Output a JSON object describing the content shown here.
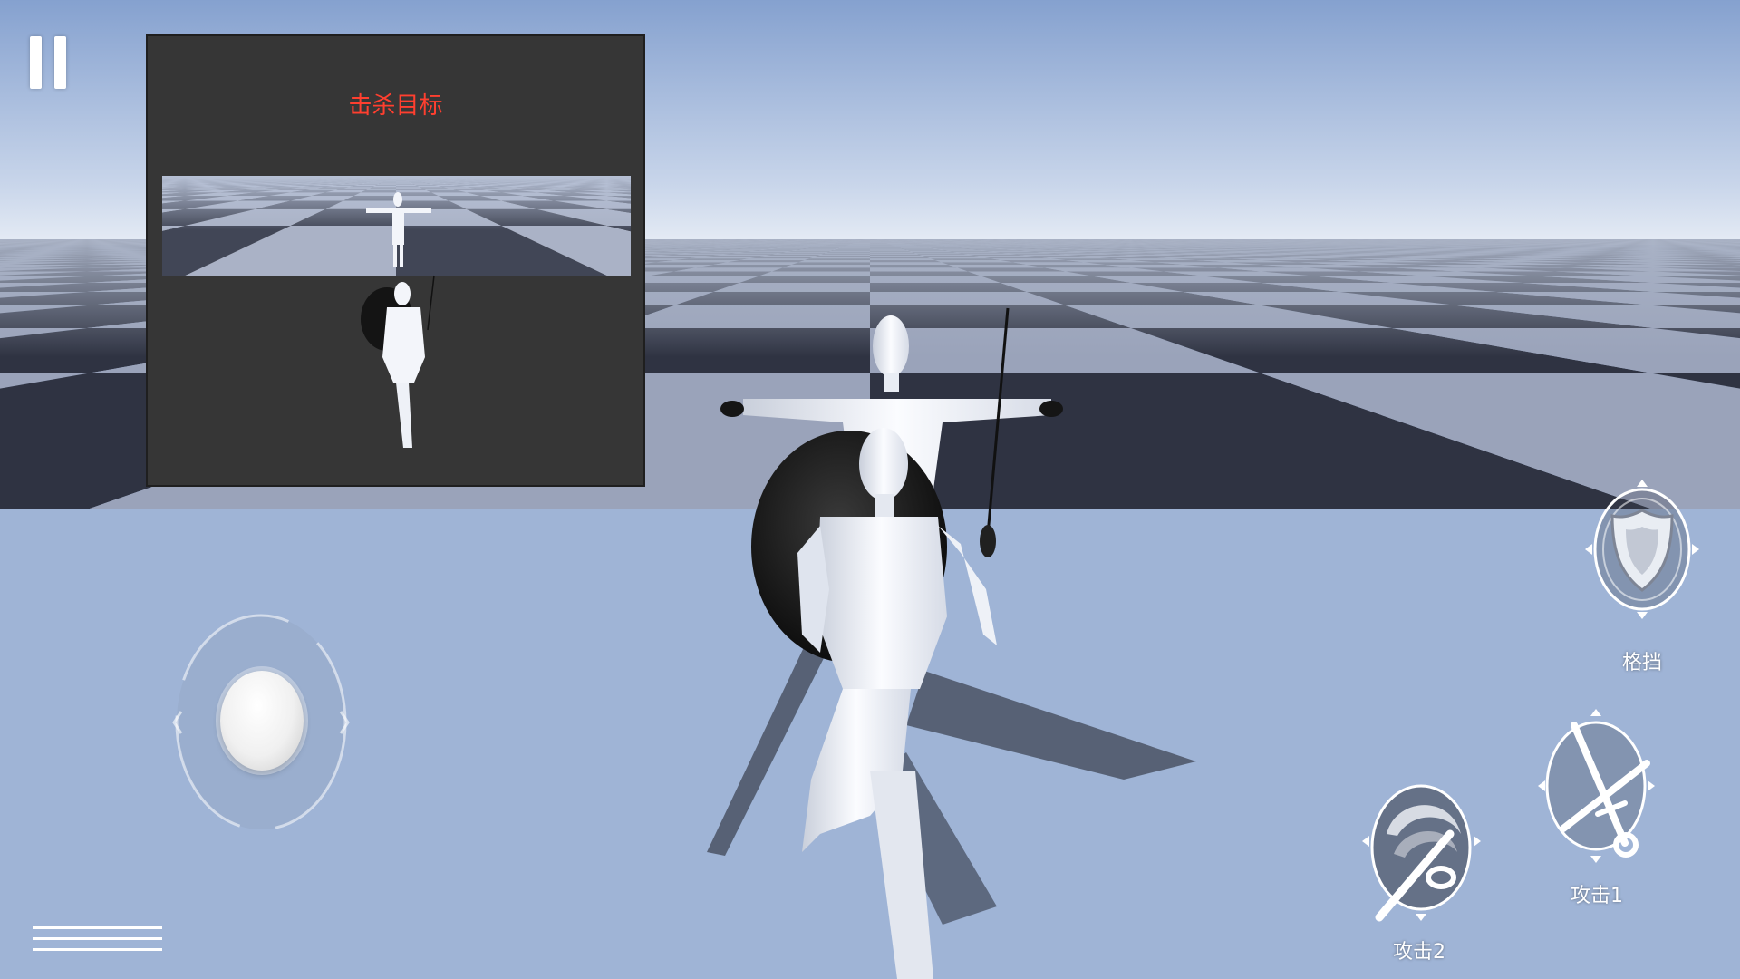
{
  "objective": {
    "title": "击杀目标"
  },
  "controls": {
    "block_label": "格挡",
    "attack1_label": "攻击1",
    "attack2_label": "攻击2"
  },
  "colors": {
    "sky_top": "#87a3d0",
    "sky_horizon": "#dfe7f2",
    "floor_light": "#9aa3ba",
    "floor_dark": "#2f3342",
    "objective_text": "#ff3f2f",
    "panel_bg": "#363636"
  },
  "icons": {
    "pause": "pause-icon",
    "menu": "hamburger-menu-icon",
    "block": "shield-icon",
    "attack1": "crossed-swords-icon",
    "attack2": "slash-swirl-icon"
  }
}
